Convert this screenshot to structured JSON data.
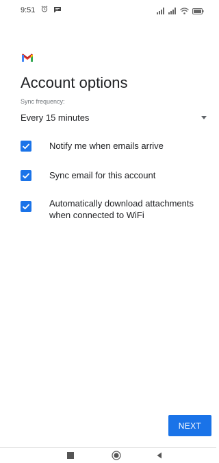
{
  "status_bar": {
    "time": "9:51",
    "icons": [
      "alarm-icon",
      "message-icon",
      "signal-icon",
      "signal-icon",
      "wifi-icon",
      "battery-icon"
    ]
  },
  "app": {
    "logo_icon": "gmail-logo-icon",
    "brand_colors": [
      "#ea4335",
      "#c5221f",
      "#4285f4",
      "#34a853",
      "#fbbc04"
    ]
  },
  "page": {
    "title": "Account options"
  },
  "sync": {
    "label": "Sync frequency:",
    "value": "Every 15 minutes"
  },
  "options": [
    {
      "label": "Notify me when emails arrive",
      "checked": true
    },
    {
      "label": "Sync email for this account",
      "checked": true
    },
    {
      "label": "Automatically download attachments when connected to WiFi",
      "checked": true
    }
  ],
  "actions": {
    "next_label": "NEXT"
  },
  "colors": {
    "accent": "#1a73e8",
    "text": "#202124",
    "secondary_text": "#70757a"
  },
  "nav_bar": {
    "icons": [
      "recent-apps-icon",
      "home-icon",
      "back-icon"
    ]
  }
}
